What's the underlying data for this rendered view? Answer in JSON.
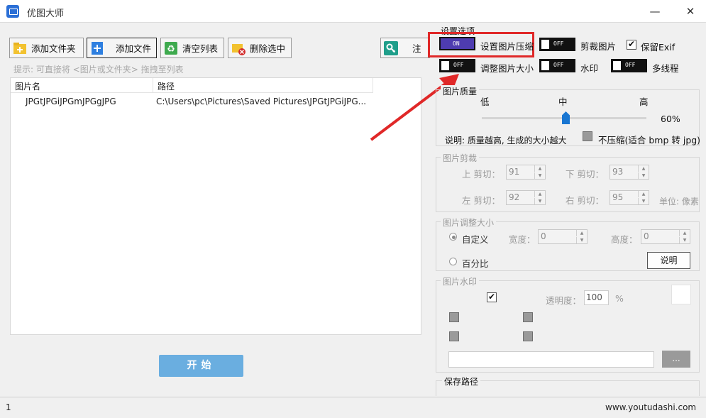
{
  "window": {
    "title": "优图大师",
    "minimize": "—",
    "close": "✕"
  },
  "toolbar": {
    "add_folder": "添加文件夹",
    "add_file": "添加文件",
    "clear_list": "清空列表",
    "delete_selected": "删除选中",
    "register": "注"
  },
  "hint": "提示: 可直接将 <图片或文件夹> 拖拽至列表",
  "file_list": {
    "columns": [
      "图片名",
      "路径"
    ],
    "rows": [
      {
        "name": "JPGtJPGiJPGmJPGgJPG",
        "path": "C:\\Users\\pc\\Pictures\\Saved Pictures\\JPGtJPGiJPG..."
      }
    ]
  },
  "start_button": "开始",
  "settings": {
    "title": "设置选项",
    "compress": {
      "state": "ON",
      "label": "设置图片压缩"
    },
    "crop": {
      "state": "OFF",
      "label": "剪裁图片"
    },
    "keep_exif": {
      "checked": true,
      "label": "保留Exif"
    },
    "resize": {
      "state": "OFF",
      "label": "调整图片大小"
    },
    "watermark": {
      "state": "OFF",
      "label": "水印"
    },
    "multithread": {
      "state": "OFF",
      "label": "多线程"
    }
  },
  "quality": {
    "title": "图片质量",
    "low": "低",
    "mid": "中",
    "high": "高",
    "value": 0.6,
    "value_label": "60%",
    "note": "说明: 质量越高, 生成的大小越大",
    "no_compress": {
      "checked": false,
      "label": "不压缩(适合 bmp 转 jpg)"
    }
  },
  "crop_group": {
    "title": "图片剪裁",
    "top_label": "上 剪切：",
    "top_value": "91",
    "bottom_label": "下 剪切：",
    "bottom_value": "93",
    "left_label": "左 剪切：",
    "left_value": "92",
    "right_label": "右 剪切：",
    "right_value": "95",
    "unit": "单位: 像素"
  },
  "resize_group": {
    "title": "图片调整大小",
    "custom": "自定义",
    "width_label": "宽度：",
    "width_value": "0",
    "height_label": "高度：",
    "height_value": "0",
    "percent": "百分比",
    "explain": "说明"
  },
  "watermark_group": {
    "title": "图片水印",
    "opacity_label": "透明度：",
    "opacity_value": "100",
    "percent_sign": "%",
    "browse": "..."
  },
  "save_path": {
    "title": "保存路径"
  },
  "status": {
    "count": "1",
    "site": "www.youtudashi.com"
  },
  "colors": {
    "highlight": "#e02828",
    "accent_on": "#4e3cb0",
    "start": "#6aaee0"
  }
}
